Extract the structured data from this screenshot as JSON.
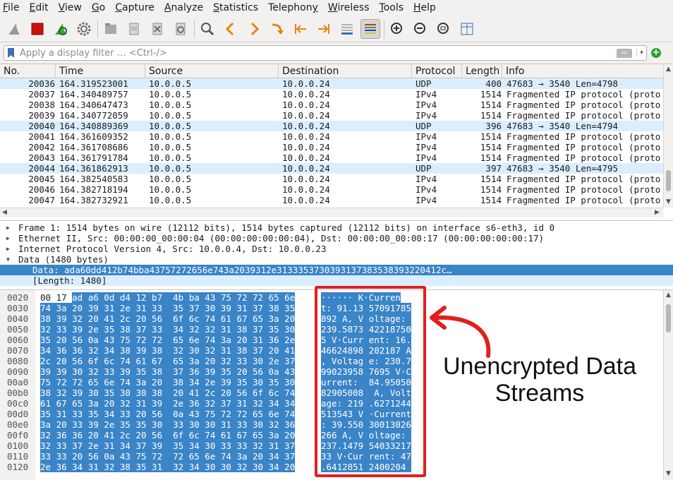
{
  "menu": [
    {
      "pre": "",
      "u": "F",
      "post": "ile"
    },
    {
      "pre": "",
      "u": "E",
      "post": "dit"
    },
    {
      "pre": "",
      "u": "V",
      "post": "iew"
    },
    {
      "pre": "",
      "u": "G",
      "post": "o"
    },
    {
      "pre": "",
      "u": "C",
      "post": "apture"
    },
    {
      "pre": "",
      "u": "A",
      "post": "nalyze"
    },
    {
      "pre": "",
      "u": "S",
      "post": "tatistics"
    },
    {
      "pre": "Telephon",
      "u": "y",
      "post": ""
    },
    {
      "pre": "",
      "u": "W",
      "post": "ireless"
    },
    {
      "pre": "",
      "u": "T",
      "post": "ools"
    },
    {
      "pre": "",
      "u": "H",
      "post": "elp"
    }
  ],
  "toolbar_icons": [
    "shark-fin-icon",
    "stop-icon",
    "restart-icon",
    "gear-icon",
    "open-folder-icon",
    "file-icon",
    "close-file-icon",
    "reload-icon",
    "find-icon",
    "go-back-icon",
    "go-forward-icon",
    "go-to-packet-icon",
    "first-packet-icon",
    "last-packet-icon",
    "autoscroll-icon",
    "colorize-icon",
    "zoom-in-icon",
    "zoom-out-icon",
    "normal-size-icon",
    "resize-columns-icon"
  ],
  "filter": {
    "placeholder": "Apply a display filter … <Ctrl-/>"
  },
  "columns": {
    "no": "No.",
    "time": "Time",
    "source": "Source",
    "destination": "Destination",
    "protocol": "Protocol",
    "length": "Length",
    "info": "Info"
  },
  "packets": [
    {
      "no": "20036",
      "time": "164.319523001",
      "src": "10.0.0.5",
      "dst": "10.0.0.24",
      "proto": "UDP",
      "len": "400",
      "info": "47683 → 3540 Len=4798"
    },
    {
      "no": "20037",
      "time": "164.340489757",
      "src": "10.0.0.5",
      "dst": "10.0.0.24",
      "proto": "IPv4",
      "len": "1514",
      "info": "Fragmented IP protocol (proto"
    },
    {
      "no": "20038",
      "time": "164.340647473",
      "src": "10.0.0.5",
      "dst": "10.0.0.24",
      "proto": "IPv4",
      "len": "1514",
      "info": "Fragmented IP protocol (proto"
    },
    {
      "no": "20039",
      "time": "164.340772059",
      "src": "10.0.0.5",
      "dst": "10.0.0.24",
      "proto": "IPv4",
      "len": "1514",
      "info": "Fragmented IP protocol (proto"
    },
    {
      "no": "20040",
      "time": "164.340889369",
      "src": "10.0.0.5",
      "dst": "10.0.0.24",
      "proto": "UDP",
      "len": "396",
      "info": "47683 → 3540 Len=4794"
    },
    {
      "no": "20041",
      "time": "164.361609352",
      "src": "10.0.0.5",
      "dst": "10.0.0.24",
      "proto": "IPv4",
      "len": "1514",
      "info": "Fragmented IP protocol (proto"
    },
    {
      "no": "20042",
      "time": "164.361708686",
      "src": "10.0.0.5",
      "dst": "10.0.0.24",
      "proto": "IPv4",
      "len": "1514",
      "info": "Fragmented IP protocol (proto"
    },
    {
      "no": "20043",
      "time": "164.361791784",
      "src": "10.0.0.5",
      "dst": "10.0.0.24",
      "proto": "IPv4",
      "len": "1514",
      "info": "Fragmented IP protocol (proto"
    },
    {
      "no": "20044",
      "time": "164.361862913",
      "src": "10.0.0.5",
      "dst": "10.0.0.24",
      "proto": "UDP",
      "len": "397",
      "info": "47683 → 3540 Len=4795"
    },
    {
      "no": "20045",
      "time": "164.382540583",
      "src": "10.0.0.5",
      "dst": "10.0.0.24",
      "proto": "IPv4",
      "len": "1514",
      "info": "Fragmented IP protocol (proto"
    },
    {
      "no": "20046",
      "time": "164.382718194",
      "src": "10.0.0.5",
      "dst": "10.0.0.24",
      "proto": "IPv4",
      "len": "1514",
      "info": "Fragmented IP protocol (proto"
    },
    {
      "no": "20047",
      "time": "164.382732921",
      "src": "10.0.0.5",
      "dst": "10.0.0.24",
      "proto": "IPv4",
      "len": "1514",
      "info": "Fragmented IP protocol (proto"
    }
  ],
  "details": [
    "Frame 1: 1514 bytes on wire (12112 bits), 1514 bytes captured (12112 bits) on interface s6-eth3, id 0",
    "Ethernet II, Src: 00:00:00_00:00:04 (00:00:00:00:00:04), Dst: 00:00:00_00:00:17 (00:00:00:00:00:17)",
    "Internet Protocol Version 4, Src: 10.0.0.4, Dst: 10.0.0.23",
    "Data (1480 bytes)"
  ],
  "data_selected": "Data: ada60dd412b74bba43757272656e743a2039312e3133353730393137383538393220412c…",
  "data_length": "[Length: 1480]",
  "bytes": [
    {
      "off": "0020",
      "pre": "00 17 ",
      "hex": "ad a6 0d d4 12 b7  4b ba 43 75 72 72 65 6e",
      "apre": "",
      "ascii": "······ K·Curren"
    },
    {
      "off": "0030",
      "pre": "",
      "hex": "74 3a 20 39 31 2e 31 33  35 37 30 39 31 37 38 35",
      "apre": "",
      "ascii": "t: 91.13 57091785"
    },
    {
      "off": "0040",
      "pre": "",
      "hex": "38 39 32 20 41 2c 20 56  6f 6c 74 61 67 65 3a 20",
      "apre": "",
      "ascii": "892 A, V oltage: "
    },
    {
      "off": "0050",
      "pre": "",
      "hex": "32 33 39 2e 35 38 37 33  34 32 32 31 38 37 35 30",
      "apre": "",
      "ascii": "239.5873 42218750"
    },
    {
      "off": "0060",
      "pre": "",
      "hex": "35 20 56 0a 43 75 72 72  65 6e 74 3a 20 31 36 2e",
      "apre": "",
      "ascii": "5 V·Curr ent: 16."
    },
    {
      "off": "0070",
      "pre": "",
      "hex": "34 36 36 32 34 38 39 38  32 30 32 31 38 37 20 41",
      "apre": "",
      "ascii": "46624898 202187 A"
    },
    {
      "off": "0080",
      "pre": "",
      "hex": "2c 20 56 6f 6c 74 61 67  65 3a 20 32 33 30 2e 37",
      "apre": "",
      "ascii": ", Voltag e: 230.7"
    },
    {
      "off": "0090",
      "pre": "",
      "hex": "39 39 30 32 33 39 35 38  37 36 39 35 20 56 0a 43",
      "apre": "",
      "ascii": "99023958 7695 V·C"
    },
    {
      "off": "00a0",
      "pre": "",
      "hex": "75 72 72 65 6e 74 3a 20  38 34 2e 39 35 30 35 30",
      "apre": "",
      "ascii": "urrent:  84.95050"
    },
    {
      "off": "00b0",
      "pre": "",
      "hex": "38 32 39 30 35 30 30 38  20 41 2c 20 56 6f 6c 74",
      "apre": "",
      "ascii": "82905008  A, Volt"
    },
    {
      "off": "00c0",
      "pre": "",
      "hex": "61 67 65 3a 20 32 31 39  2e 36 32 37 31 32 34 34",
      "apre": "",
      "ascii": "age: 219 .6271244"
    },
    {
      "off": "00d0",
      "pre": "",
      "hex": "35 31 33 35 34 33 20 56  0a 43 75 72 72 65 6e 74",
      "apre": "",
      "ascii": "513543 V ·Current"
    },
    {
      "off": "00e0",
      "pre": "",
      "hex": "3a 20 33 39 2e 35 35 30  33 30 30 31 33 30 32 36",
      "apre": "",
      "ascii": ": 39.550 30013026"
    },
    {
      "off": "00f0",
      "pre": "",
      "hex": "32 36 36 20 41 2c 20 56  6f 6c 74 61 67 65 3a 20",
      "apre": "",
      "ascii": "266 A, V oltage: "
    },
    {
      "off": "0100",
      "pre": "",
      "hex": "32 33 37 2e 31 34 37 39  35 34 30 33 33 32 31 37",
      "apre": "",
      "ascii": "237.1479 54033217"
    },
    {
      "off": "0110",
      "pre": "",
      "hex": "33 33 20 56 0a 43 75 72  72 65 6e 74 3a 20 34 37",
      "apre": "",
      "ascii": "33 V·Cur rent: 47"
    },
    {
      "off": "0120",
      "pre": "",
      "hex": "2e 36 34 31 32 38 35 31  32 34 30 30 32 30 34 20",
      "apre": "",
      "ascii": ".6412851 2400204 "
    }
  ],
  "annotation": {
    "line1": "Unencrypted Data",
    "line2": "Streams"
  },
  "colors": {
    "udp_row": "#daeeff",
    "selection": "#3a84c8",
    "annotation": "#e0201b"
  }
}
